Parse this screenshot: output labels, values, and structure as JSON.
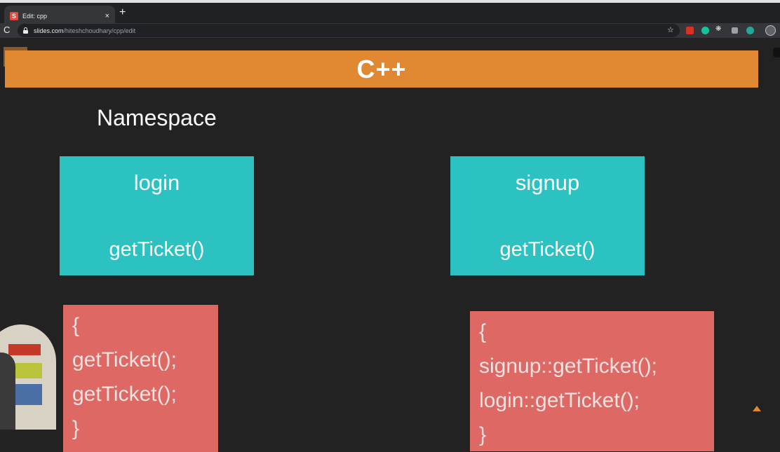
{
  "browser": {
    "tab_title": "Edit: cpp",
    "tab_close": "×",
    "new_tab": "+",
    "url_domain": "slides.com",
    "url_path": "/hiteshchoudhary/cpp/edit",
    "favicon_letter": "S"
  },
  "icons": {
    "reload": "C",
    "star": "☆",
    "ext3": "❋"
  },
  "slide": {
    "title": "C++",
    "heading": "Namespace",
    "namespaces": [
      {
        "name": "login",
        "function": "getTicket()"
      },
      {
        "name": "signup",
        "function": "getTicket()"
      }
    ],
    "code_left": [
      "{",
      "getTicket();",
      "getTicket();",
      "}"
    ],
    "code_right": [
      "{",
      "signup::getTicket();",
      "login::getTicket();",
      "}"
    ]
  },
  "colors": {
    "banner": "#e08832",
    "namespace_box": "#2cc2c2",
    "code_box": "#dd6864",
    "background": "#222222"
  }
}
